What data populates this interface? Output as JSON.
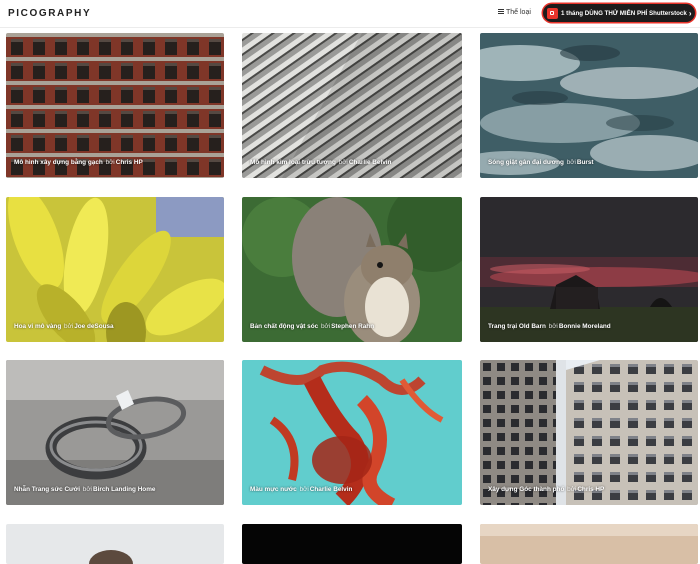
{
  "header": {
    "logo": "PICOGRAPHY",
    "categories_label": "Thể loại",
    "promo_label": "1 tháng DÙNG THỬ MIỄN PHÍ Shutterstock",
    "icons": [
      "menu-icon",
      "shutterstock-icon",
      "chevron-right-icon"
    ]
  },
  "gallery": {
    "by_word": "bởi",
    "items": [
      {
        "title": "Mô hình xây dựng bằng gạch",
        "author": "Chris HP"
      },
      {
        "title": "Mô hình kim loại trừu tượng",
        "author": "Charlie Belvin"
      },
      {
        "title": "Sóng giật gân đại dương",
        "author": "Burst"
      },
      {
        "title": "Hoa vi mô vàng",
        "author": "Joe deSousa"
      },
      {
        "title": "Bản chất động vật sóc",
        "author": "Stephen Rahn"
      },
      {
        "title": "Trang trại Old Barn",
        "author": "Bonnie Moreland"
      },
      {
        "title": "Nhẫn Trang sức Cưới",
        "author": "Birch Landing Home"
      },
      {
        "title": "Màu mực nước",
        "author": "Charlie Belvin"
      },
      {
        "title": "Xây dựng Góc thành phố",
        "author": "Chris HP"
      }
    ]
  },
  "colors": {
    "accent": "#e8342b",
    "promo_bg": "#1c1c1c"
  }
}
